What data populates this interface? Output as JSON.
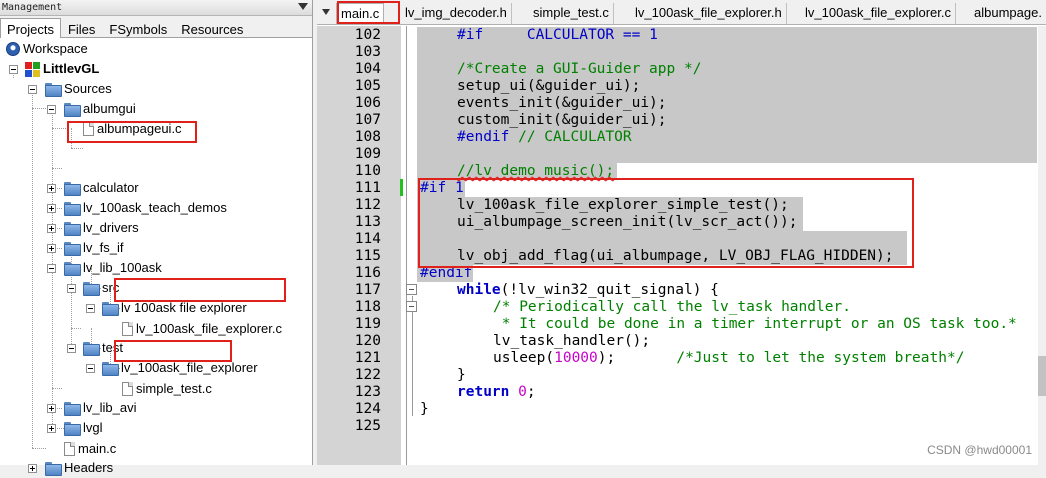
{
  "left_panel": {
    "title": "Management",
    "tabs": [
      "Projects",
      "Files",
      "FSymbols",
      "Resources"
    ],
    "tree": {
      "workspace": "Workspace",
      "project": "LittlevGL",
      "sources": "Sources",
      "albumgui": "albumgui",
      "albumpageui_c": "albumpageui.c",
      "calculator": "calculator",
      "lv_100ask_teach_demos": "lv_100ask_teach_demos",
      "lv_drivers": "lv_drivers",
      "lv_fs_if": "lv_fs_if",
      "lv_lib_100ask": "lv_lib_100ask",
      "src": "src",
      "src_explorer": "lv 100ask file explorer",
      "explorer_c": "lv_100ask_file_explorer.c",
      "test": "test",
      "test_explorer": "lv_100ask_file_explorer",
      "simple_test_c": "simple_test.c",
      "lv_lib_avi": "lv_lib_avi",
      "lvgl": "lvgl",
      "main_c": "main.c",
      "headers": "Headers"
    }
  },
  "editor": {
    "tabs": [
      "main.c",
      "lv_img_decoder.h",
      "simple_test.c",
      "lv_100ask_file_explorer.h",
      "lv_100ask_file_explorer.c",
      "albumpage."
    ],
    "active_tab": "main.c",
    "line_numbers": [
      "102",
      "103",
      "104",
      "105",
      "106",
      "107",
      "108",
      "109",
      "110",
      "111",
      "112",
      "113",
      "114",
      "115",
      "116",
      "117",
      "118",
      "119",
      "120",
      "121",
      "122",
      "123",
      "124",
      "125"
    ],
    "code": {
      "l102_pp": "#if",
      "l102_rest": "     CALCULATOR == 1",
      "l104": "/*Create a GUI-Guider app */",
      "l105": "setup_ui(&guider_ui);",
      "l106": "events_init(&guider_ui);",
      "l107": "custom_init(&guider_ui);",
      "l108_pp": "#endif",
      "l108_cm": " // CALCULATOR",
      "l110": "//lv_demo_music();",
      "l111_pp": "#if",
      "l111_num": "1",
      "l112": "lv_100ask_file_explorer_simple_test();",
      "l113": "ui_albumpage_screen_init(lv_scr_act());",
      "l115": "lv_obj_add_flag(ui_albumpage, LV_OBJ_FLAG_HIDDEN);",
      "l116": "#endif",
      "l117_kw": "while",
      "l117_rest": "(!lv_win32_quit_signal) {",
      "l118": "/* Periodically call the lv_task handler.",
      "l119": " * It could be done in a timer interrupt or an OS task too.*",
      "l120": "lv_task_handler();",
      "l121_a": "usleep(",
      "l121_num": "10000",
      "l121_b": ");       ",
      "l121_cm": "/*Just to let the system breath*/",
      "l122": "}",
      "l123_kw": "return",
      "l123_num": "0",
      "l123_end": ";",
      "l124": "}"
    }
  },
  "watermark": "CSDN @hwd00001"
}
